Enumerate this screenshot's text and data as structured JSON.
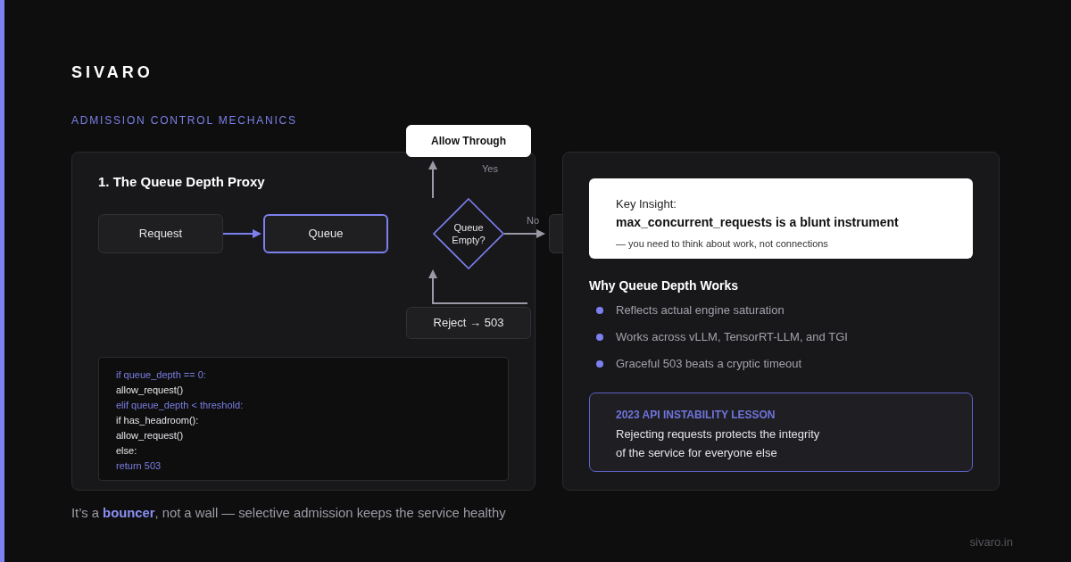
{
  "brand": {
    "logo": "SIVARO"
  },
  "section_label": "ADMISSION CONTROL MECHANICS",
  "diagram_card": {
    "title": "1. The Queue Depth Proxy",
    "nodes": [
      {
        "kind": "accept",
        "label": "Allow Through"
      },
      {
        "kind": "step",
        "label": "Request"
      },
      {
        "kind": "focus",
        "label": "Queue"
      },
      {
        "kind": "decision",
        "label": "Queue Empty?"
      },
      {
        "kind": "clipped"
      },
      {
        "kind": "step",
        "label": "Reject → 503"
      }
    ],
    "edges": [
      {
        "kind": "branch",
        "label": "Yes"
      },
      {
        "kind": "flow"
      },
      {
        "kind": "branch",
        "label": "No"
      },
      {
        "kind": "loop"
      }
    ],
    "code_lines": [
      {
        "text": "if queue_depth == 0:",
        "highlight": true
      },
      {
        "text": "allow_request()",
        "highlight": false
      },
      {
        "text": "elif queue_depth < threshold:",
        "highlight": true
      },
      {
        "text": "if has_headroom():",
        "highlight": false
      },
      {
        "text": "allow_request()",
        "highlight": false
      },
      {
        "text": "else:",
        "highlight": false
      },
      {
        "text": "return 503",
        "highlight": true
      }
    ]
  },
  "insight_card": {
    "callout": {
      "label": "Key Insight:",
      "headline": "max_concurrent_requests is a blunt instrument",
      "note": "— you need to think about work, not connections"
    },
    "list_title": "Why Queue Depth Works",
    "points": [
      "Reflects actual engine saturation",
      "Works across vLLM, TensorRT-LLM, and TGI",
      "Graceful 503 beats a cryptic timeout"
    ],
    "lesson": {
      "title": "2023 API INSTABILITY LESSON",
      "text": "Rejecting requests protects the integrity\nof the service for everyone else"
    }
  },
  "caption": "It’s a **bouncer**, not a wall — selective admission keeps the service healthy",
  "footer": "sivaro.in"
}
